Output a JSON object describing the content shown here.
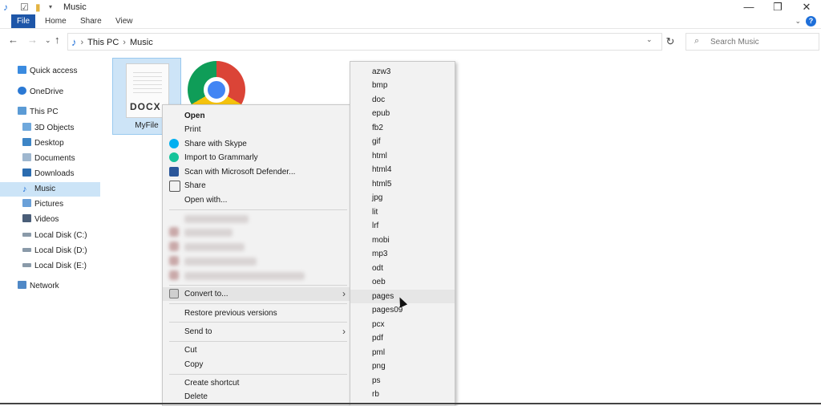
{
  "window": {
    "title": "Music"
  },
  "ribbon": {
    "tabs": [
      "File",
      "Home",
      "Share",
      "View"
    ]
  },
  "address": {
    "crumbs": [
      "This PC",
      "Music"
    ]
  },
  "search": {
    "placeholder": "Search Music"
  },
  "nav": {
    "items": [
      {
        "label": "Quick access",
        "icon": "star-icon"
      },
      {
        "label": "OneDrive",
        "icon": "cloud-icon"
      },
      {
        "label": "This PC",
        "icon": "computer-icon"
      },
      {
        "label": "3D Objects",
        "icon": "cube-icon"
      },
      {
        "label": "Desktop",
        "icon": "desktop-icon"
      },
      {
        "label": "Documents",
        "icon": "document-icon"
      },
      {
        "label": "Downloads",
        "icon": "download-icon"
      },
      {
        "label": "Music",
        "icon": "music-icon",
        "selected": true
      },
      {
        "label": "Pictures",
        "icon": "picture-icon"
      },
      {
        "label": "Videos",
        "icon": "video-icon"
      },
      {
        "label": "Local Disk (C:)",
        "icon": "drive-icon"
      },
      {
        "label": "Local Disk (D:)",
        "icon": "drive-icon"
      },
      {
        "label": "Local Disk (E:)",
        "icon": "drive-icon"
      },
      {
        "label": "Network",
        "icon": "network-icon"
      }
    ]
  },
  "files": [
    {
      "name": "MyFile",
      "badge": "DOCX",
      "selected": true
    },
    {
      "name": "",
      "icon": "chrome-icon"
    }
  ],
  "context_menu": {
    "open": "Open",
    "print": "Print",
    "skype": "Share with Skype",
    "grammarly": "Import to Grammarly",
    "defender": "Scan with Microsoft Defender...",
    "share": "Share",
    "open_with": "Open with...",
    "convert": "Convert to...",
    "restore": "Restore previous versions",
    "send_to": "Send to",
    "cut": "Cut",
    "copy": "Copy",
    "create_shortcut": "Create shortcut",
    "delete": "Delete"
  },
  "submenu": {
    "formats": [
      "azw3",
      "bmp",
      "doc",
      "epub",
      "fb2",
      "gif",
      "html",
      "html4",
      "html5",
      "jpg",
      "lit",
      "lrf",
      "mobi",
      "mp3",
      "odt",
      "oeb",
      "pages",
      "pages09",
      "pcx",
      "pdf",
      "pml",
      "png",
      "ps",
      "rb"
    ],
    "hovered": "pages"
  },
  "colors": {
    "file_tab": "#1e56a8",
    "selection": "#cce4f7",
    "accent": "#1e6fd9"
  }
}
